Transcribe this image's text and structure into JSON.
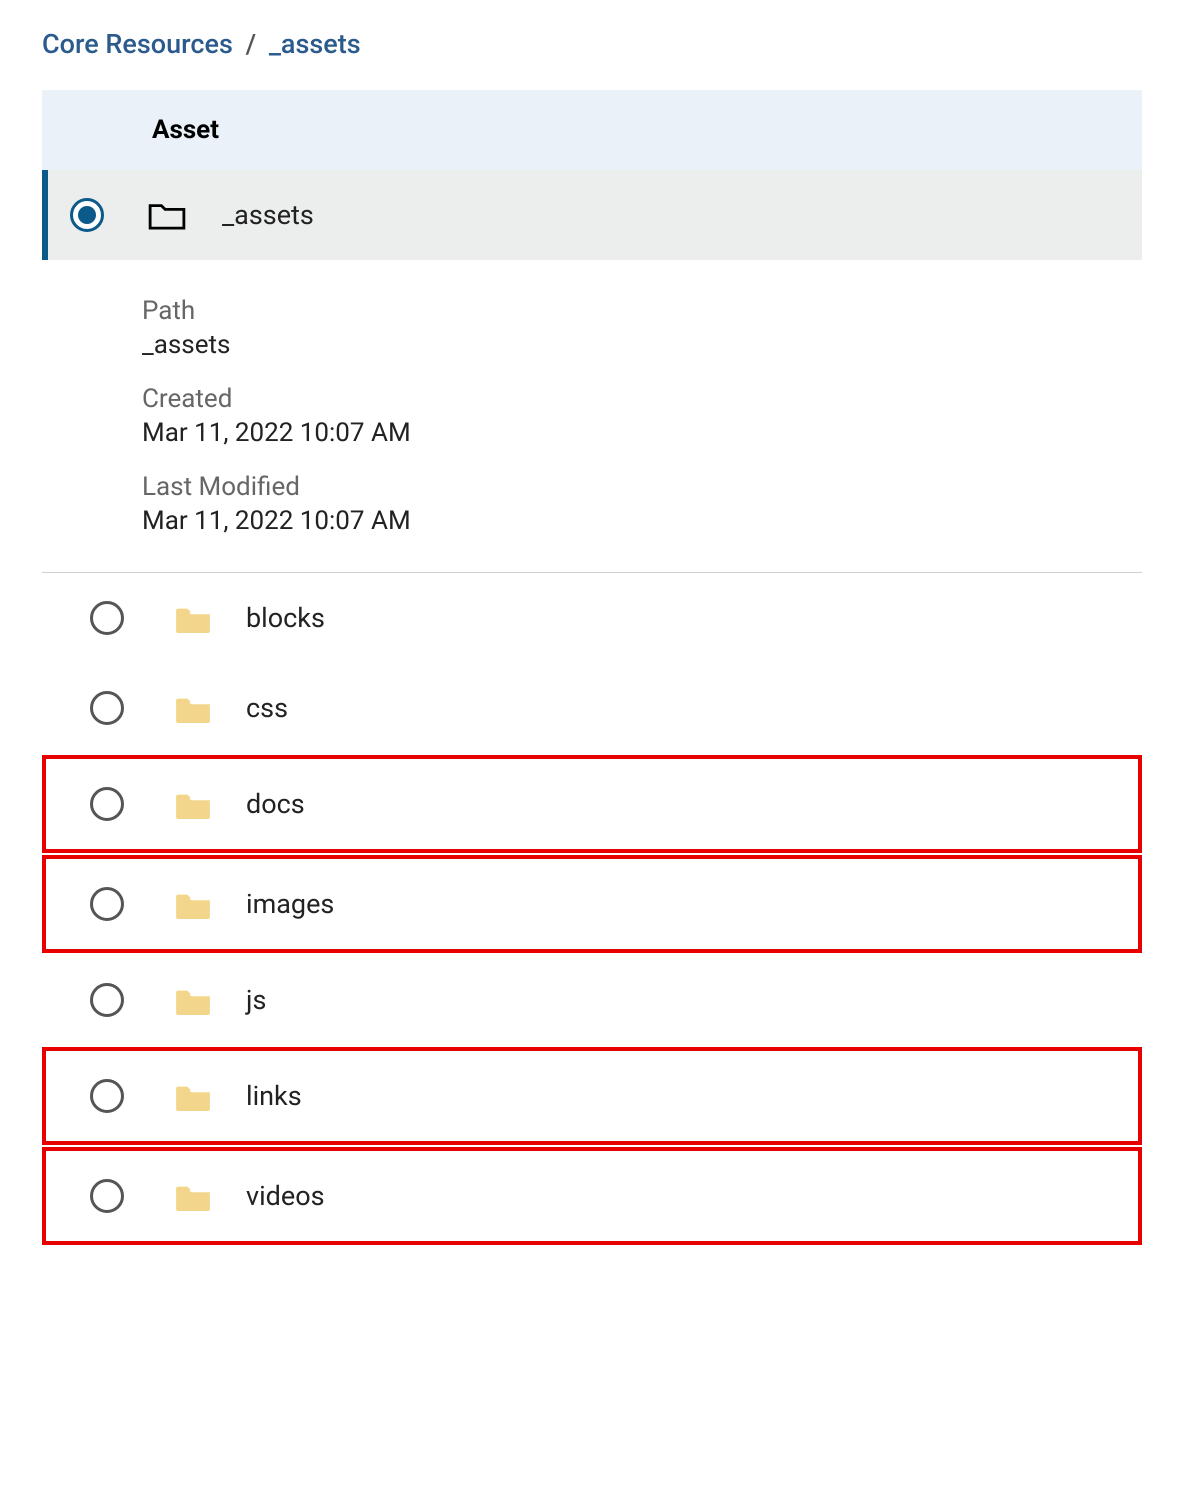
{
  "breadcrumbs": {
    "root": "Core Resources",
    "separator": "/",
    "current": "_assets"
  },
  "table": {
    "header": "Asset",
    "selected": {
      "name": "_assets"
    },
    "details": {
      "path_label": "Path",
      "path_value": "_assets",
      "created_label": "Created",
      "created_value": "Mar 11, 2022 10:07 AM",
      "modified_label": "Last Modified",
      "modified_value": "Mar 11, 2022 10:07 AM"
    },
    "items": [
      {
        "name": "blocks",
        "highlighted": false
      },
      {
        "name": "css",
        "highlighted": false
      },
      {
        "name": "docs",
        "highlighted": true
      },
      {
        "name": "images",
        "highlighted": true
      },
      {
        "name": "js",
        "highlighted": false
      },
      {
        "name": "links",
        "highlighted": true
      },
      {
        "name": "videos",
        "highlighted": true
      }
    ]
  },
  "colors": {
    "accent": "#0c5a8a",
    "folder": "#f3d68b",
    "highlight": "#e60000"
  }
}
